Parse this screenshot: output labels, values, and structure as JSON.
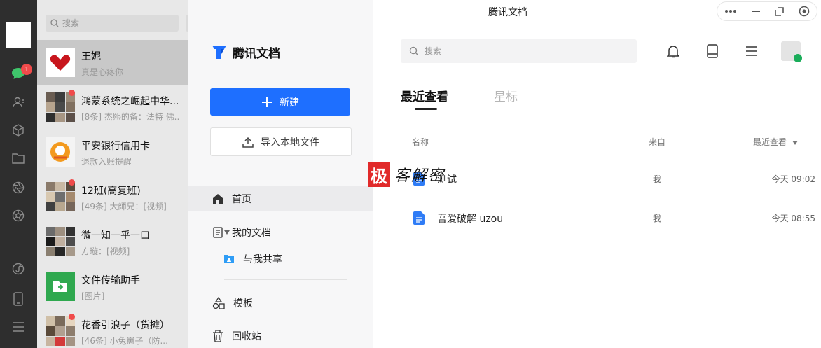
{
  "wechat": {
    "unread_badge": "1",
    "search_placeholder": "搜索",
    "chats": [
      {
        "name": "王妮",
        "preview": "真是心疼你"
      },
      {
        "name": "鸿蒙系统之崛起中华...",
        "preview": "[8条] 杰熙的备：法特 佛..."
      },
      {
        "name": "平安银行信用卡",
        "preview": "退款入账提醒"
      },
      {
        "name": "12班(高复班)",
        "preview": "[49条] 大師兄：[视频]"
      },
      {
        "name": "微一知一乎一口",
        "preview": "方璇：[视频]"
      },
      {
        "name": "文件传输助手",
        "preview": "[图片]"
      },
      {
        "name": "花香引浪子（货摊）",
        "preview": "[46条] 小兔崽子（防..."
      }
    ]
  },
  "docs": {
    "window_title": "腾讯文档",
    "brand": "腾讯文档",
    "new_button": "新建",
    "import_button": "导入本地文件",
    "nav": {
      "home": "首页",
      "my_docs": "我的文档",
      "shared": "与我共享",
      "templates": "模板",
      "trash": "回收站"
    },
    "search_placeholder": "搜索",
    "tabs": {
      "recent": "最近查看",
      "starred": "星标"
    },
    "columns": {
      "name": "名称",
      "source": "来自",
      "recent": "最近查看"
    },
    "files": [
      {
        "name": "测试",
        "source": "我",
        "time": "今天 09:02"
      },
      {
        "name": "吾爱破解 uzou",
        "source": "我",
        "time": "今天 08:55"
      }
    ],
    "watermark": {
      "logo_char": "极",
      "text": "客解密"
    },
    "colors": {
      "accent": "#1e6fff",
      "doc_icon": "#2f7cf6"
    }
  }
}
